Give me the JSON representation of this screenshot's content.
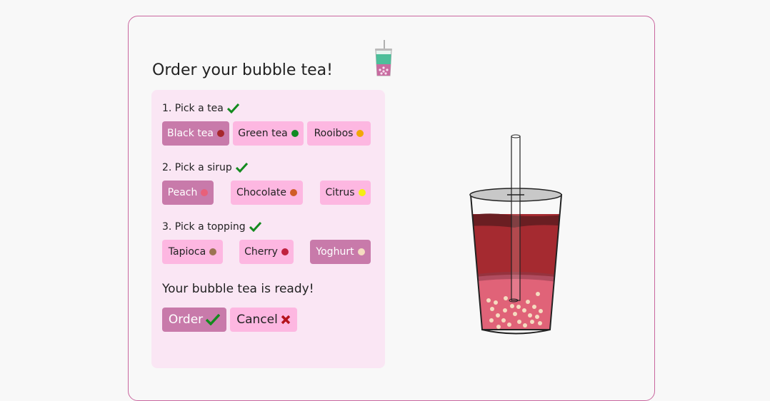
{
  "form": {
    "title": "Order your bubble tea!",
    "steps": [
      {
        "label": "1. Pick a tea",
        "options": [
          {
            "label": "Black tea",
            "color": "#a6282c",
            "selected": true
          },
          {
            "label": "Green tea",
            "color": "#128a23",
            "selected": false
          },
          {
            "label": "Rooibos",
            "color": "#f2a705",
            "selected": false
          }
        ]
      },
      {
        "label": "2. Pick a sirup",
        "options": [
          {
            "label": "Peach",
            "color": "#e8607a",
            "selected": true
          },
          {
            "label": "Chocolate",
            "color": "#d05d27",
            "selected": false
          },
          {
            "label": "Citrus",
            "color": "#f5ee12",
            "selected": false
          }
        ]
      },
      {
        "label": "3. Pick a topping",
        "options": [
          {
            "label": "Tapioca",
            "color": "#9b7352",
            "selected": false
          },
          {
            "label": "Cherry",
            "color": "#c0203e",
            "selected": false
          },
          {
            "label": "Yoghurt",
            "color": "#f5dcc0",
            "selected": true
          }
        ]
      }
    ],
    "status": "Your bubble tea is ready!",
    "order_label": "Order",
    "cancel_label": "Cancel"
  },
  "icons": {
    "step_complete": "check-icon",
    "order": "check-icon",
    "cancel": "cross-icon",
    "logo": "bubble-tea-logo-icon",
    "preview": "bubble-tea-cup"
  },
  "colors": {
    "selected_bg": "#c87aaa",
    "option_bg": "#fdb7e1",
    "panel_bg": "#fae6f4",
    "border": "#c9679f",
    "check": "#138a1e",
    "cross": "#b5121b"
  }
}
